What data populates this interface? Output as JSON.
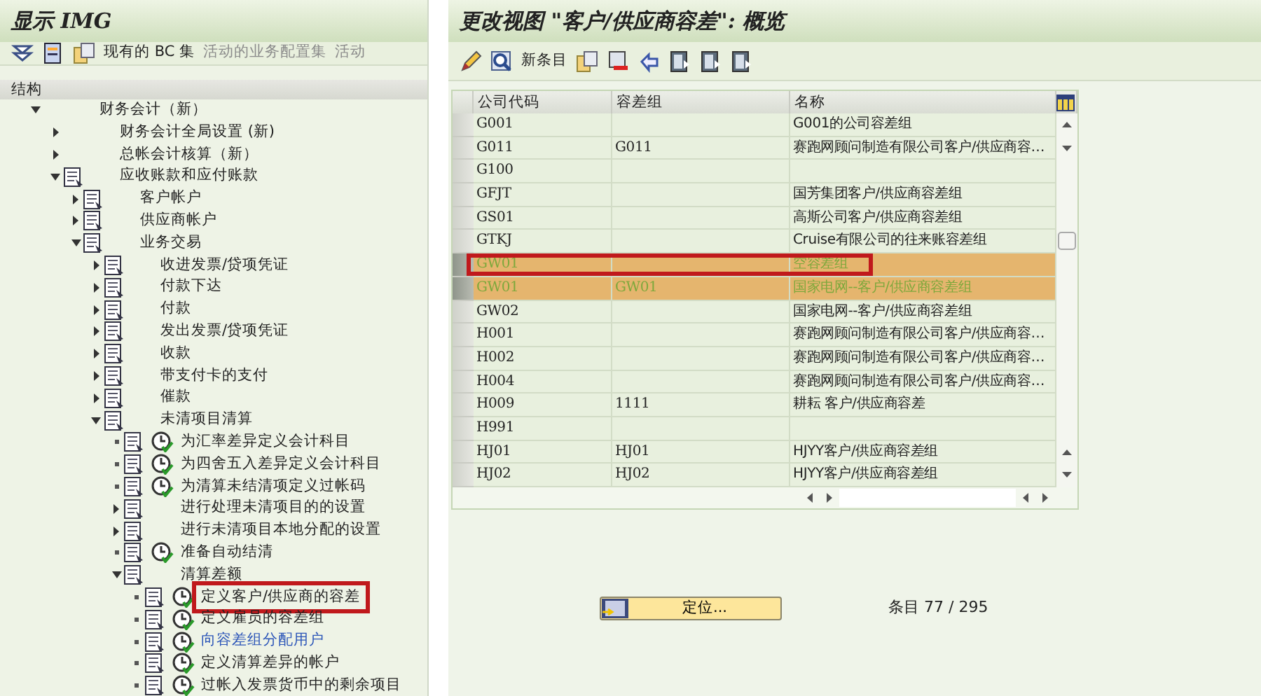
{
  "left_pane": {
    "title": "显示 IMG",
    "toolbar": [
      {
        "kind": "icon"
      },
      {
        "kind": "icon"
      },
      {
        "kind": "icon"
      },
      {
        "kind": "text",
        "label": "现有的 BC 集",
        "disabled": false
      },
      {
        "kind": "text",
        "label": "活动的业务配置集",
        "disabled": true
      },
      {
        "kind": "text",
        "label": "活动",
        "disabled": true
      }
    ],
    "tree_header": "结构",
    "tree": [
      {
        "label": "财务会计（新）",
        "doc_icon": false,
        "clock_icon": false,
        "expanded": true,
        "children": [
          {
            "label": "财务会计全局设置 (新)",
            "doc_icon": false,
            "clock_icon": false,
            "expanded": false
          },
          {
            "label": "总帐会计核算（新）",
            "doc_icon": false,
            "clock_icon": false,
            "expanded": false
          },
          {
            "label": "应收账款和应付账款",
            "doc_icon": true,
            "clock_icon": false,
            "expanded": true,
            "children": [
              {
                "label": "客户帐户",
                "doc_icon": true,
                "clock_icon": false,
                "expanded": false
              },
              {
                "label": "供应商帐户",
                "doc_icon": true,
                "clock_icon": false,
                "expanded": false
              },
              {
                "label": "业务交易",
                "doc_icon": true,
                "clock_icon": false,
                "expanded": true,
                "children": [
                  {
                    "label": "收进发票/贷项凭证",
                    "doc_icon": true,
                    "clock_icon": false,
                    "expanded": false
                  },
                  {
                    "label": "付款下达",
                    "doc_icon": true,
                    "clock_icon": false,
                    "expanded": false
                  },
                  {
                    "label": "付款",
                    "doc_icon": true,
                    "clock_icon": false,
                    "expanded": false
                  },
                  {
                    "label": "发出发票/贷项凭证",
                    "doc_icon": true,
                    "clock_icon": false,
                    "expanded": false
                  },
                  {
                    "label": "收款",
                    "doc_icon": true,
                    "clock_icon": false,
                    "expanded": false
                  },
                  {
                    "label": "带支付卡的支付",
                    "doc_icon": true,
                    "clock_icon": false,
                    "expanded": false
                  },
                  {
                    "label": "催款",
                    "doc_icon": true,
                    "clock_icon": false,
                    "expanded": false
                  },
                  {
                    "label": "未清项目清算",
                    "doc_icon": true,
                    "clock_icon": false,
                    "expanded": true,
                    "children": [
                      {
                        "label": "为汇率差异定义会计科目",
                        "doc_icon": true,
                        "clock_icon": true,
                        "kind": "leaf"
                      },
                      {
                        "label": "为四舍五入差异定义会计科目",
                        "doc_icon": true,
                        "clock_icon": true,
                        "kind": "leaf"
                      },
                      {
                        "label": "为清算未结清项定义过帐码",
                        "doc_icon": true,
                        "clock_icon": true,
                        "kind": "leaf"
                      },
                      {
                        "label": "进行处理未清项目的的设置",
                        "doc_icon": true,
                        "clock_icon": false,
                        "expanded": false
                      },
                      {
                        "label": "进行未清项目本地分配的设置",
                        "doc_icon": true,
                        "clock_icon": false,
                        "expanded": false
                      },
                      {
                        "label": "准备自动结清",
                        "doc_icon": true,
                        "clock_icon": true,
                        "kind": "leaf"
                      },
                      {
                        "label": "清算差额",
                        "doc_icon": true,
                        "clock_icon": false,
                        "expanded": true,
                        "children": [
                          {
                            "label": "定义客户/供应商的容差",
                            "doc_icon": true,
                            "clock_icon": true,
                            "kind": "leaf",
                            "marked": true
                          },
                          {
                            "label": "定义雇员的容差组",
                            "doc_icon": true,
                            "clock_icon": true,
                            "kind": "leaf"
                          },
                          {
                            "label": "向容差组分配用户",
                            "doc_icon": true,
                            "clock_icon": true,
                            "kind": "leaf",
                            "visited": true
                          },
                          {
                            "label": "定义清算差异的帐户",
                            "doc_icon": true,
                            "clock_icon": true,
                            "kind": "leaf"
                          },
                          {
                            "label": "过帐入发票货币中的剩余项目",
                            "doc_icon": true,
                            "clock_icon": true,
                            "kind": "leaf"
                          }
                        ]
                      }
                    ]
                  }
                ]
              }
            ]
          }
        ]
      }
    ]
  },
  "right_pane": {
    "title": "更改视图 \"客户/供应商容差\": 概览",
    "toolbar": [
      {
        "kind": "icon"
      },
      {
        "kind": "icon"
      },
      {
        "kind": "text",
        "label": "新条目"
      },
      {
        "kind": "icon"
      },
      {
        "kind": "icon"
      },
      {
        "kind": "icon"
      },
      {
        "kind": "icon"
      },
      {
        "kind": "icon"
      },
      {
        "kind": "icon"
      }
    ],
    "table": {
      "columns": [
        "公司代码",
        "容差组",
        "名称"
      ],
      "rows": [
        {
          "cells": [
            "G001",
            "",
            "G001的公司容差组"
          ],
          "selected": false
        },
        {
          "cells": [
            "G011",
            "G011",
            "赛跑网顾问制造有限公司客户/供应商容…"
          ],
          "selected": false
        },
        {
          "cells": [
            "G100",
            "",
            ""
          ],
          "selected": false
        },
        {
          "cells": [
            "GFJT",
            "",
            "国芳集团客户/供应商容差组"
          ],
          "selected": false
        },
        {
          "cells": [
            "GS01",
            "",
            "高斯公司客户/供应商容差组"
          ],
          "selected": false
        },
        {
          "cells": [
            "GTKJ",
            "",
            "Cruise有限公司的往来账容差组"
          ],
          "selected": false
        },
        {
          "cells": [
            "GW01",
            "",
            "空容差组"
          ],
          "selected": true,
          "marked": true
        },
        {
          "cells": [
            "GW01",
            "GW01",
            "国家电网--客户/供应商容差组"
          ],
          "selected": true
        },
        {
          "cells": [
            "GW02",
            "",
            "国家电网--客户/供应商容差组"
          ],
          "selected": false
        },
        {
          "cells": [
            "H001",
            "",
            "赛跑网顾问制造有限公司客户/供应商容…"
          ],
          "selected": false
        },
        {
          "cells": [
            "H002",
            "",
            "赛跑网顾问制造有限公司客户/供应商容…"
          ],
          "selected": false
        },
        {
          "cells": [
            "H004",
            "",
            "赛跑网顾问制造有限公司客户/供应商容…"
          ],
          "selected": false
        },
        {
          "cells": [
            "H009",
            "1111",
            "耕耘 客户/供应商容差"
          ],
          "selected": false
        },
        {
          "cells": [
            "H991",
            "",
            ""
          ],
          "selected": false
        },
        {
          "cells": [
            "HJ01",
            "HJ01",
            "HJYY客户/供应商容差组"
          ],
          "selected": false
        },
        {
          "cells": [
            "HJ02",
            "HJ02",
            "HJYY客户/供应商容差组"
          ],
          "selected": false
        }
      ]
    },
    "position_button": "定位...",
    "entry_count": "条目 77 / 295"
  }
}
